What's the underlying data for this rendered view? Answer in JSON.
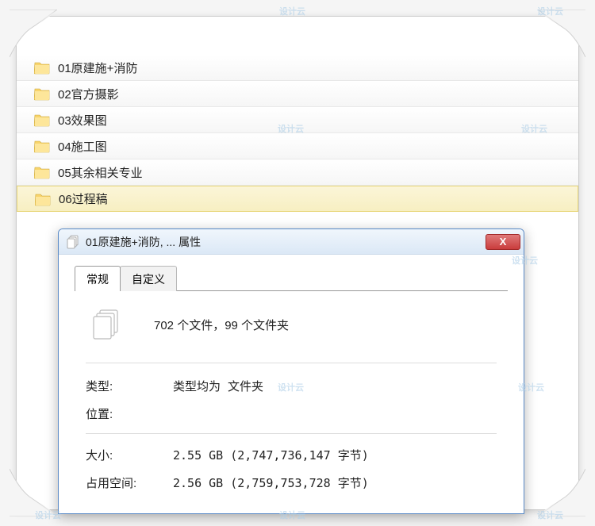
{
  "watermark_text": "设计云",
  "folders": [
    {
      "label": "01原建施+消防",
      "selected": false
    },
    {
      "label": "02官方摄影",
      "selected": false
    },
    {
      "label": "03效果图",
      "selected": false
    },
    {
      "label": "04施工图",
      "selected": false
    },
    {
      "label": "05其余相关专业",
      "selected": false
    },
    {
      "label": "06过程稿",
      "selected": true
    }
  ],
  "dialog": {
    "title": "01原建施+消防, ... 属性",
    "tabs": {
      "general": "常规",
      "custom": "自定义"
    },
    "summary": "702 个文件，99 个文件夹",
    "labels": {
      "type": "类型:",
      "location": "位置:",
      "size": "大小:",
      "disk": "占用空间:"
    },
    "values": {
      "type": "类型均为 文件夹",
      "location": "",
      "size": "2.55 GB (2,747,736,147 字节)",
      "disk": "2.56 GB (2,759,753,728 字节)"
    },
    "close_symbol": "X"
  }
}
